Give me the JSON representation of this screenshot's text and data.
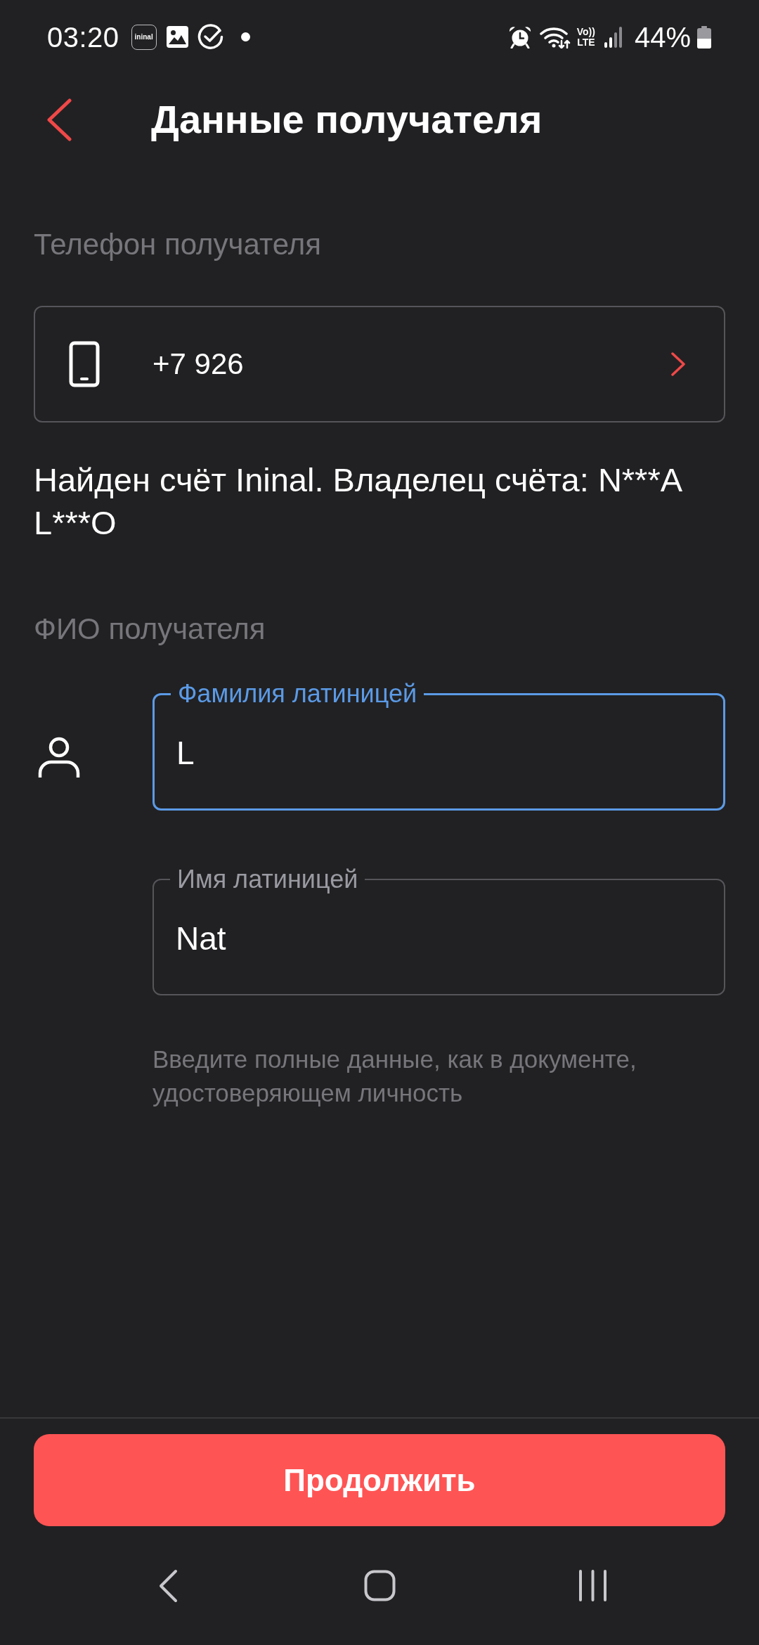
{
  "status_bar": {
    "time": "03:20",
    "app_logo": "ininal",
    "network_type": {
      "top": "Vo))",
      "bottom": "LTE"
    },
    "battery": "44%"
  },
  "header": {
    "title": "Данные получателя"
  },
  "phone_section": {
    "label": "Телефон получателя",
    "value": "+7 926"
  },
  "account_notice": "Найден счёт Ininal. Владелец счёта: N***A L***O",
  "name_section": {
    "label": "ФИО получателя",
    "fields": [
      {
        "label": "Фамилия латиницей",
        "value": "L",
        "focused": true
      },
      {
        "label": "Имя латиницей",
        "value": "Nat",
        "focused": false
      }
    ],
    "hint": "Введите полные данные, как в документе, удостоверяющем личность"
  },
  "continue_button": {
    "label": "Продолжить"
  }
}
